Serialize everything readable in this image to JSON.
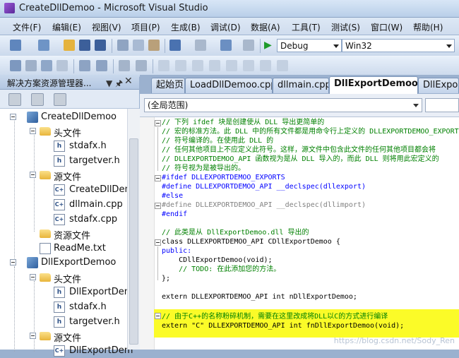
{
  "window": {
    "title": "CreateDllDemoo - Microsoft Visual Studio"
  },
  "menu": [
    "文件(F)",
    "编辑(E)",
    "视图(V)",
    "项目(P)",
    "生成(B)",
    "调试(D)",
    "数据(A)",
    "工具(T)",
    "测试(S)",
    "窗口(W)",
    "帮助(H)"
  ],
  "toolbar": {
    "config": "Debug",
    "platform": "Win32"
  },
  "solution_explorer": {
    "title": "解决方案资源管理器...",
    "pin_glyph": "▼ 🖈",
    "close_glyph": "✕",
    "tree": [
      {
        "label": "CreateDllDemoo",
        "kind": "project"
      },
      {
        "label": "头文件",
        "kind": "folder"
      },
      {
        "label": "stdafx.h",
        "kind": "h"
      },
      {
        "label": "targetver.h",
        "kind": "h"
      },
      {
        "label": "源文件",
        "kind": "folder"
      },
      {
        "label": "CreateDllDem",
        "kind": "cpp"
      },
      {
        "label": "dllmain.cpp",
        "kind": "cpp"
      },
      {
        "label": "stdafx.cpp",
        "kind": "cpp"
      },
      {
        "label": "资源文件",
        "kind": "folder"
      },
      {
        "label": "ReadMe.txt",
        "kind": "txt"
      },
      {
        "label": "DllExportDemoo",
        "kind": "project"
      },
      {
        "label": "头文件",
        "kind": "folder"
      },
      {
        "label": "DllExportDem",
        "kind": "h"
      },
      {
        "label": "stdafx.h",
        "kind": "h"
      },
      {
        "label": "targetver.h",
        "kind": "h"
      },
      {
        "label": "源文件",
        "kind": "folder"
      },
      {
        "label": "DllExportDem",
        "kind": "cpp"
      }
    ]
  },
  "tabs": [
    "起始页",
    "LoadDllDemoo.cpp",
    "dllmain.cpp",
    "DllExportDemoo.h",
    "DllExpor"
  ],
  "active_tab": "DllExportDemoo.h",
  "scope": "(全局范围)",
  "code_lines": [
    {
      "text": "// 下列 ifdef 块是创建使从 DLL 导出更简单的",
      "style": "comment"
    },
    {
      "text": "// 宏的标准方法。此 DLL 中的所有文件都是用命令行上定义的 DLLEXPORTDEMOO_EXPORTS",
      "style": "comment"
    },
    {
      "text": "// 符号编译的。在使用此 DLL 的",
      "style": "comment"
    },
    {
      "text": "// 任何其他项目上不应定义此符号。这样，源文件中包含此文件的任何其他项目都会将",
      "style": "comment"
    },
    {
      "text": "// DLLEXPORTDEMOO_API 函数视为是从 DLL 导入的，而此 DLL 则将用此宏定义的",
      "style": "comment"
    },
    {
      "text": "// 符号视为是被导出的。",
      "style": "comment"
    },
    {
      "text": "#ifdef DLLEXPORTDEMOO_EXPORTS",
      "style": "pp"
    },
    {
      "text": "#define DLLEXPORTDEMOO_API __declspec(dllexport)",
      "style": "pp"
    },
    {
      "text": "#else",
      "style": "pp"
    },
    {
      "text": "#define DLLEXPORTDEMOO_API __declspec(dllimport)",
      "style": "gray"
    },
    {
      "text": "#endif",
      "style": "pp"
    },
    {
      "text": "",
      "style": "plain"
    },
    {
      "text": "// 此类是从 DllExportDemoo.dll 导出的",
      "style": "comment"
    },
    {
      "text": "class DLLEXPORTDEMOO_API CDllExportDemoo {",
      "style": "class"
    },
    {
      "text": "public:",
      "style": "kw"
    },
    {
      "text": "    CDllExportDemoo(void);",
      "style": "ctor"
    },
    {
      "text": "    // TODO: 在此添加您的方法。",
      "style": "comment"
    },
    {
      "text": "};",
      "style": "plain"
    },
    {
      "text": "",
      "style": "plain"
    },
    {
      "text": "extern DLLEXPORTDEMOO_API int nDllExportDemoo;",
      "style": "extern"
    },
    {
      "text": "",
      "style": "plain"
    },
    {
      "text": "// 由于C++的名称粉碎机制，需要在这里改成将DLL以C的方式进行编译",
      "style": "comment"
    },
    {
      "text": "extern \"C\" DLLEXPORTDEMOO_API int fnDllExportDemoo(void);",
      "style": "externc"
    }
  ],
  "watermark": "https://blog.csdn.net/Sody_Ren"
}
